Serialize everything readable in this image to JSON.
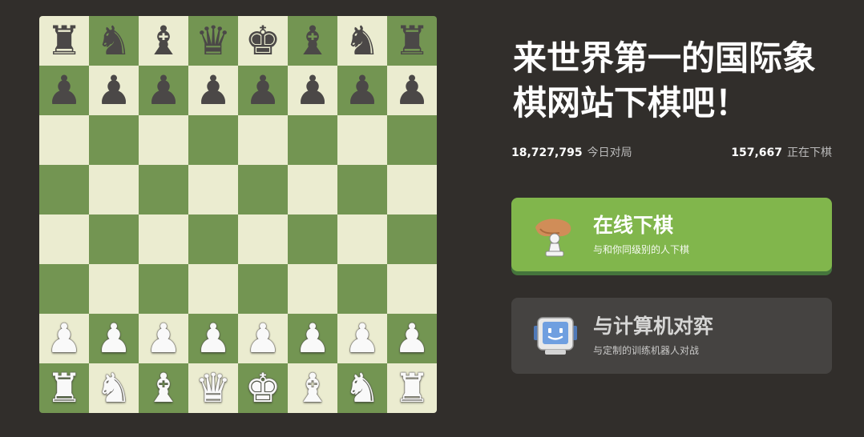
{
  "board": {
    "rows": [
      [
        "♜",
        "♞",
        "♝",
        "♛",
        "♚",
        "♝",
        "♞",
        "♜"
      ],
      [
        "♟",
        "♟",
        "♟",
        "♟",
        "♟",
        "♟",
        "♟",
        "♟"
      ],
      [
        "",
        "",
        "",
        "",
        "",
        "",
        "",
        ""
      ],
      [
        "",
        "",
        "",
        "",
        "",
        "",
        "",
        ""
      ],
      [
        "",
        "",
        "",
        "",
        "",
        "",
        "",
        ""
      ],
      [
        "",
        "",
        "",
        "",
        "",
        "",
        "",
        ""
      ],
      [
        "♟",
        "♟",
        "♟",
        "♟",
        "♟",
        "♟",
        "♟",
        "♟"
      ],
      [
        "♜",
        "♞",
        "♝",
        "♛",
        "♚",
        "♝",
        "♞",
        "♜"
      ]
    ],
    "light_color": "#ebecd0",
    "dark_color": "#739552"
  },
  "headline": "来世界第一的国际象棋网站下棋吧！",
  "stats": {
    "games_today_value": "18,727,795",
    "games_today_label": "今日对局",
    "playing_now_value": "157,667",
    "playing_now_label": "正在下棋"
  },
  "play_online": {
    "title": "在线下棋",
    "subtitle": "与和你同级别的人下棋",
    "icon": "hand-pawn-icon",
    "color": "#81b64c"
  },
  "play_computer": {
    "title": "与计算机对弈",
    "subtitle": "与定制的训练机器人对战",
    "icon": "robot-computer-icon",
    "color": "#454341"
  }
}
